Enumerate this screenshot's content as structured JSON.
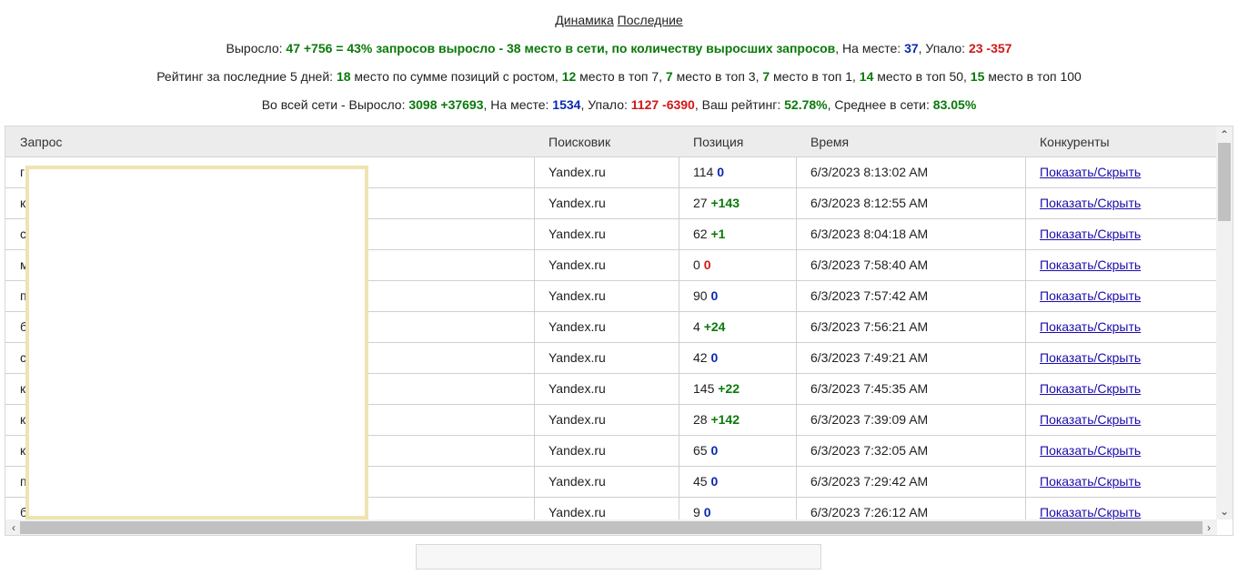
{
  "nav": {
    "link1": "Динамика",
    "link2": "Последние"
  },
  "stats1": {
    "label": "Выросло: ",
    "grew": "47 +756 = 43% запросов выросло - 38 место в сети, по количеству выросших запросов",
    "stay_label": ", На месте: ",
    "stay": "37",
    "fell_label": ", Упало: ",
    "fell": "23 -357"
  },
  "stats2": {
    "t1": "Рейтинг за последние 5 дней: ",
    "v1": "18",
    "t2": " место по сумме позиций с ростом, ",
    "v2": "12",
    "t3": " место в топ 7, ",
    "v3": "7",
    "t4": " место в топ 3, ",
    "v4": "7",
    "t5": " место в топ 1, ",
    "v5": "14",
    "t6": " место в топ 50, ",
    "v6": "15",
    "t7": " место в топ 100"
  },
  "stats3": {
    "t1": "Во всей сети - Выросло: ",
    "grew": "3098 +37693",
    "t2": ", На месте: ",
    "stay": "1534",
    "t3": ", Упало: ",
    "fell": "1127 -6390",
    "t4": ", Ваш рейтинг: ",
    "rating": "52.78%",
    "t5": ", Среднее в сети: ",
    "avg": "83.05%"
  },
  "table": {
    "headers": {
      "query": "Запрос",
      "engine": "Поисковик",
      "position": "Позиция",
      "time": "Время",
      "competitors": "Конкуренты"
    },
    "rows": [
      {
        "q": "г",
        "engine": "Yandex.ru",
        "pos": "114",
        "delta": "0",
        "cls": "b",
        "time": "6/3/2023 8:13:02 AM",
        "link": "Показать/Скрыть"
      },
      {
        "q": "к",
        "engine": "Yandex.ru",
        "pos": "27",
        "delta": "+143",
        "cls": "g",
        "time": "6/3/2023 8:12:55 AM",
        "link": "Показать/Скрыть"
      },
      {
        "q": "с",
        "engine": "Yandex.ru",
        "pos": "62",
        "delta": "+1",
        "cls": "g",
        "time": "6/3/2023 8:04:18 AM",
        "link": "Показать/Скрыть"
      },
      {
        "q": "м",
        "engine": "Yandex.ru",
        "pos": "0",
        "delta": "0",
        "cls": "r",
        "time": "6/3/2023 7:58:40 AM",
        "link": "Показать/Скрыть"
      },
      {
        "q": "п",
        "engine": "Yandex.ru",
        "pos": "90",
        "delta": "0",
        "cls": "b",
        "time": "6/3/2023 7:57:42 AM",
        "link": "Показать/Скрыть"
      },
      {
        "q": "б",
        "engine": "Yandex.ru",
        "pos": "4",
        "delta": "+24",
        "cls": "g",
        "time": "6/3/2023 7:56:21 AM",
        "link": "Показать/Скрыть"
      },
      {
        "q": "с",
        "engine": "Yandex.ru",
        "pos": "42",
        "delta": "0",
        "cls": "b",
        "time": "6/3/2023 7:49:21 AM",
        "link": "Показать/Скрыть"
      },
      {
        "q": "к",
        "engine": "Yandex.ru",
        "pos": "145",
        "delta": "+22",
        "cls": "g",
        "time": "6/3/2023 7:45:35 AM",
        "link": "Показать/Скрыть"
      },
      {
        "q": "к",
        "engine": "Yandex.ru",
        "pos": "28",
        "delta": "+142",
        "cls": "g",
        "time": "6/3/2023 7:39:09 AM",
        "link": "Показать/Скрыть"
      },
      {
        "q": "к",
        "engine": "Yandex.ru",
        "pos": "65",
        "delta": "0",
        "cls": "b",
        "time": "6/3/2023 7:32:05 AM",
        "link": "Показать/Скрыть"
      },
      {
        "q": "п",
        "engine": "Yandex.ru",
        "pos": "45",
        "delta": "0",
        "cls": "b",
        "time": "6/3/2023 7:29:42 AM",
        "link": "Показать/Скрыть"
      },
      {
        "q": "б",
        "engine": "Yandex.ru",
        "pos": "9",
        "delta": "0",
        "cls": "b",
        "time": "6/3/2023 7:26:12 AM",
        "link": "Показать/Скрыть"
      }
    ]
  },
  "scroll": {
    "up": "⌃",
    "down": "⌄",
    "left": "‹",
    "right": "›"
  },
  "colors": {
    "positive": "#0a7a0a",
    "neutral": "#0a2ab0",
    "negative": "#d01818"
  }
}
